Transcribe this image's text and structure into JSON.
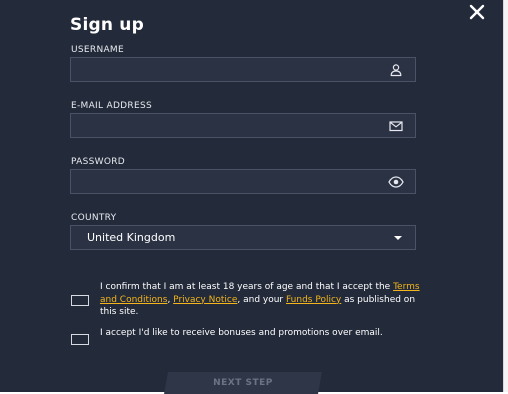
{
  "modal": {
    "title": "Sign up",
    "close_icon": "close-icon"
  },
  "fields": {
    "username": {
      "label": "USERNAME",
      "value": "",
      "icon": "user-icon"
    },
    "email": {
      "label": "E-MAIL ADDRESS",
      "value": "",
      "icon": "envelope-icon"
    },
    "password": {
      "label": "PASSWORD",
      "value": "",
      "icon": "eye-icon"
    },
    "country": {
      "label": "COUNTRY",
      "selected": "United Kingdom",
      "icon": "caret-down-icon"
    }
  },
  "consent_age": {
    "text_1": "I confirm that I am at least 18 years of age and that I accept the ",
    "link_terms": "Terms and Conditions",
    "sep_1": ", ",
    "link_privacy": "Privacy Notice",
    "text_2": ", and your ",
    "link_funds": "Funds Policy",
    "text_3": " as published on this site."
  },
  "consent_bonus": {
    "text": "I accept I'd like to receive bonuses and promotions over email."
  },
  "next_button": {
    "label": "NEXT STEP"
  },
  "colors": {
    "background": "#232a3a",
    "field_bg": "#2b3244",
    "field_border": "#4a5266",
    "link": "#f3b51b",
    "button_disabled_text": "#6c7385"
  }
}
